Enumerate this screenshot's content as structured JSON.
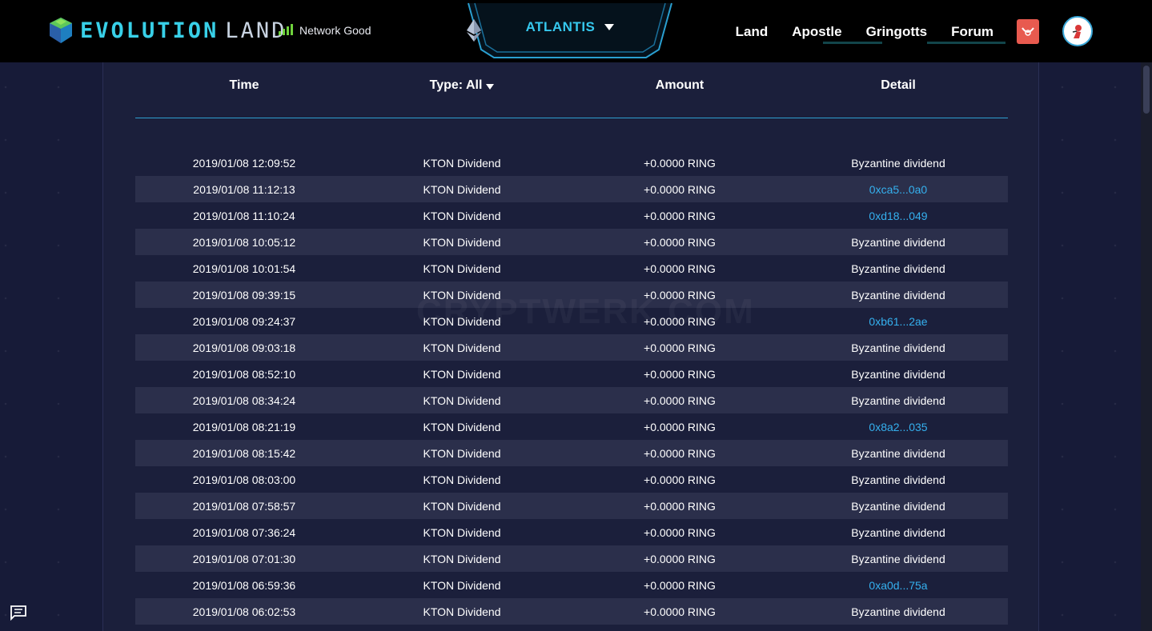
{
  "header": {
    "logo_text_1": "EVOLUTION",
    "logo_text_2": "LAND",
    "network_status": "Network Good",
    "realm": "ATLANTIS",
    "nav": [
      {
        "label": "Land"
      },
      {
        "label": "Apostle"
      },
      {
        "label": "Gringotts"
      },
      {
        "label": "Forum"
      }
    ]
  },
  "table": {
    "columns": {
      "time": "Time",
      "type": "Type: All",
      "amount": "Amount",
      "detail": "Detail"
    },
    "rows": [
      {
        "time": "2019/01/08 12:09:52",
        "type": "KTON Dividend",
        "amount": "+0.0000 RING",
        "detail": "Byzantine dividend",
        "link": false
      },
      {
        "time": "2019/01/08 11:12:13",
        "type": "KTON Dividend",
        "amount": "+0.0000 RING",
        "detail": "0xca5...0a0",
        "link": true
      },
      {
        "time": "2019/01/08 11:10:24",
        "type": "KTON Dividend",
        "amount": "+0.0000 RING",
        "detail": "0xd18...049",
        "link": true
      },
      {
        "time": "2019/01/08 10:05:12",
        "type": "KTON Dividend",
        "amount": "+0.0000 RING",
        "detail": "Byzantine dividend",
        "link": false
      },
      {
        "time": "2019/01/08 10:01:54",
        "type": "KTON Dividend",
        "amount": "+0.0000 RING",
        "detail": "Byzantine dividend",
        "link": false
      },
      {
        "time": "2019/01/08 09:39:15",
        "type": "KTON Dividend",
        "amount": "+0.0000 RING",
        "detail": "Byzantine dividend",
        "link": false
      },
      {
        "time": "2019/01/08 09:24:37",
        "type": "KTON Dividend",
        "amount": "+0.0000 RING",
        "detail": "0xb61...2ae",
        "link": true
      },
      {
        "time": "2019/01/08 09:03:18",
        "type": "KTON Dividend",
        "amount": "+0.0000 RING",
        "detail": "Byzantine dividend",
        "link": false
      },
      {
        "time": "2019/01/08 08:52:10",
        "type": "KTON Dividend",
        "amount": "+0.0000 RING",
        "detail": "Byzantine dividend",
        "link": false
      },
      {
        "time": "2019/01/08 08:34:24",
        "type": "KTON Dividend",
        "amount": "+0.0000 RING",
        "detail": "Byzantine dividend",
        "link": false
      },
      {
        "time": "2019/01/08 08:21:19",
        "type": "KTON Dividend",
        "amount": "+0.0000 RING",
        "detail": "0x8a2...035",
        "link": true
      },
      {
        "time": "2019/01/08 08:15:42",
        "type": "KTON Dividend",
        "amount": "+0.0000 RING",
        "detail": "Byzantine dividend",
        "link": false
      },
      {
        "time": "2019/01/08 08:03:00",
        "type": "KTON Dividend",
        "amount": "+0.0000 RING",
        "detail": "Byzantine dividend",
        "link": false
      },
      {
        "time": "2019/01/08 07:58:57",
        "type": "KTON Dividend",
        "amount": "+0.0000 RING",
        "detail": "Byzantine dividend",
        "link": false
      },
      {
        "time": "2019/01/08 07:36:24",
        "type": "KTON Dividend",
        "amount": "+0.0000 RING",
        "detail": "Byzantine dividend",
        "link": false
      },
      {
        "time": "2019/01/08 07:01:30",
        "type": "KTON Dividend",
        "amount": "+0.0000 RING",
        "detail": "Byzantine dividend",
        "link": false
      },
      {
        "time": "2019/01/08 06:59:36",
        "type": "KTON Dividend",
        "amount": "+0.0000 RING",
        "detail": "0xa0d...75a",
        "link": true
      },
      {
        "time": "2019/01/08 06:02:53",
        "type": "KTON Dividend",
        "amount": "+0.0000 RING",
        "detail": "Byzantine dividend",
        "link": false
      }
    ]
  },
  "watermark": "CRYPTWERK.COM",
  "colors": {
    "accent": "#36c8ee",
    "link": "#35b0ee",
    "signal": "#6fd23c",
    "background": "#171b38",
    "panel": "#1b1f3b",
    "row_alt": "#2b2f4b"
  },
  "icons": {
    "logo": "evolution-land-logo-icon",
    "network": "signal-bars-icon",
    "realm": "ethereum-icon",
    "badge": "red-envelope-icon",
    "avatar": "user-avatar-icon",
    "chat": "chat-bubble-icon"
  }
}
